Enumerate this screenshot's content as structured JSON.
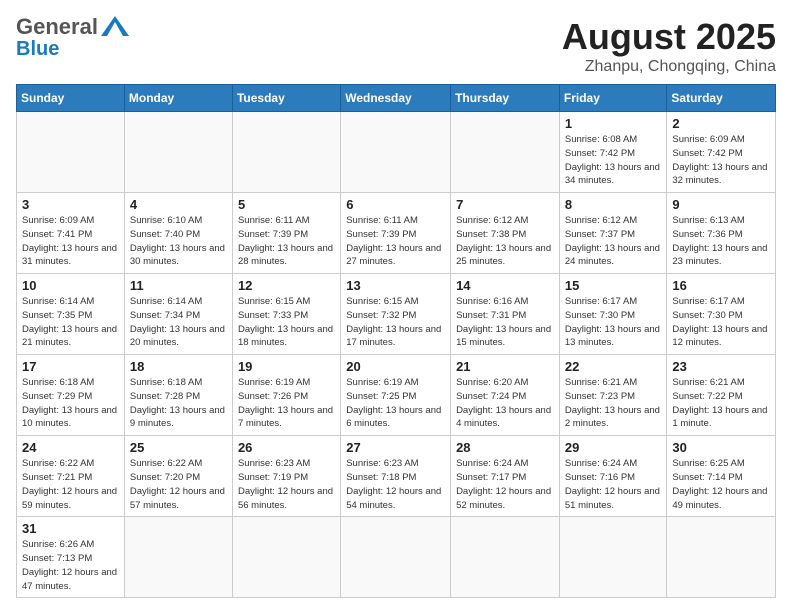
{
  "header": {
    "logo": {
      "general": "General",
      "blue": "Blue"
    },
    "month": "August 2025",
    "location": "Zhanpu, Chongqing, China"
  },
  "weekdays": [
    "Sunday",
    "Monday",
    "Tuesday",
    "Wednesday",
    "Thursday",
    "Friday",
    "Saturday"
  ],
  "days": [
    {
      "date": null,
      "info": null
    },
    {
      "date": null,
      "info": null
    },
    {
      "date": null,
      "info": null
    },
    {
      "date": null,
      "info": null
    },
    {
      "date": null,
      "info": null
    },
    {
      "date": "1",
      "info": "Sunrise: 6:08 AM\nSunset: 7:42 PM\nDaylight: 13 hours and 34 minutes."
    },
    {
      "date": "2",
      "info": "Sunrise: 6:09 AM\nSunset: 7:42 PM\nDaylight: 13 hours and 32 minutes."
    },
    {
      "date": "3",
      "info": "Sunrise: 6:09 AM\nSunset: 7:41 PM\nDaylight: 13 hours and 31 minutes."
    },
    {
      "date": "4",
      "info": "Sunrise: 6:10 AM\nSunset: 7:40 PM\nDaylight: 13 hours and 30 minutes."
    },
    {
      "date": "5",
      "info": "Sunrise: 6:11 AM\nSunset: 7:39 PM\nDaylight: 13 hours and 28 minutes."
    },
    {
      "date": "6",
      "info": "Sunrise: 6:11 AM\nSunset: 7:39 PM\nDaylight: 13 hours and 27 minutes."
    },
    {
      "date": "7",
      "info": "Sunrise: 6:12 AM\nSunset: 7:38 PM\nDaylight: 13 hours and 25 minutes."
    },
    {
      "date": "8",
      "info": "Sunrise: 6:12 AM\nSunset: 7:37 PM\nDaylight: 13 hours and 24 minutes."
    },
    {
      "date": "9",
      "info": "Sunrise: 6:13 AM\nSunset: 7:36 PM\nDaylight: 13 hours and 23 minutes."
    },
    {
      "date": "10",
      "info": "Sunrise: 6:14 AM\nSunset: 7:35 PM\nDaylight: 13 hours and 21 minutes."
    },
    {
      "date": "11",
      "info": "Sunrise: 6:14 AM\nSunset: 7:34 PM\nDaylight: 13 hours and 20 minutes."
    },
    {
      "date": "12",
      "info": "Sunrise: 6:15 AM\nSunset: 7:33 PM\nDaylight: 13 hours and 18 minutes."
    },
    {
      "date": "13",
      "info": "Sunrise: 6:15 AM\nSunset: 7:32 PM\nDaylight: 13 hours and 17 minutes."
    },
    {
      "date": "14",
      "info": "Sunrise: 6:16 AM\nSunset: 7:31 PM\nDaylight: 13 hours and 15 minutes."
    },
    {
      "date": "15",
      "info": "Sunrise: 6:17 AM\nSunset: 7:30 PM\nDaylight: 13 hours and 13 minutes."
    },
    {
      "date": "16",
      "info": "Sunrise: 6:17 AM\nSunset: 7:30 PM\nDaylight: 13 hours and 12 minutes."
    },
    {
      "date": "17",
      "info": "Sunrise: 6:18 AM\nSunset: 7:29 PM\nDaylight: 13 hours and 10 minutes."
    },
    {
      "date": "18",
      "info": "Sunrise: 6:18 AM\nSunset: 7:28 PM\nDaylight: 13 hours and 9 minutes."
    },
    {
      "date": "19",
      "info": "Sunrise: 6:19 AM\nSunset: 7:26 PM\nDaylight: 13 hours and 7 minutes."
    },
    {
      "date": "20",
      "info": "Sunrise: 6:19 AM\nSunset: 7:25 PM\nDaylight: 13 hours and 6 minutes."
    },
    {
      "date": "21",
      "info": "Sunrise: 6:20 AM\nSunset: 7:24 PM\nDaylight: 13 hours and 4 minutes."
    },
    {
      "date": "22",
      "info": "Sunrise: 6:21 AM\nSunset: 7:23 PM\nDaylight: 13 hours and 2 minutes."
    },
    {
      "date": "23",
      "info": "Sunrise: 6:21 AM\nSunset: 7:22 PM\nDaylight: 13 hours and 1 minute."
    },
    {
      "date": "24",
      "info": "Sunrise: 6:22 AM\nSunset: 7:21 PM\nDaylight: 12 hours and 59 minutes."
    },
    {
      "date": "25",
      "info": "Sunrise: 6:22 AM\nSunset: 7:20 PM\nDaylight: 12 hours and 57 minutes."
    },
    {
      "date": "26",
      "info": "Sunrise: 6:23 AM\nSunset: 7:19 PM\nDaylight: 12 hours and 56 minutes."
    },
    {
      "date": "27",
      "info": "Sunrise: 6:23 AM\nSunset: 7:18 PM\nDaylight: 12 hours and 54 minutes."
    },
    {
      "date": "28",
      "info": "Sunrise: 6:24 AM\nSunset: 7:17 PM\nDaylight: 12 hours and 52 minutes."
    },
    {
      "date": "29",
      "info": "Sunrise: 6:24 AM\nSunset: 7:16 PM\nDaylight: 12 hours and 51 minutes."
    },
    {
      "date": "30",
      "info": "Sunrise: 6:25 AM\nSunset: 7:14 PM\nDaylight: 12 hours and 49 minutes."
    },
    {
      "date": "31",
      "info": "Sunrise: 6:26 AM\nSunset: 7:13 PM\nDaylight: 12 hours and 47 minutes."
    }
  ]
}
